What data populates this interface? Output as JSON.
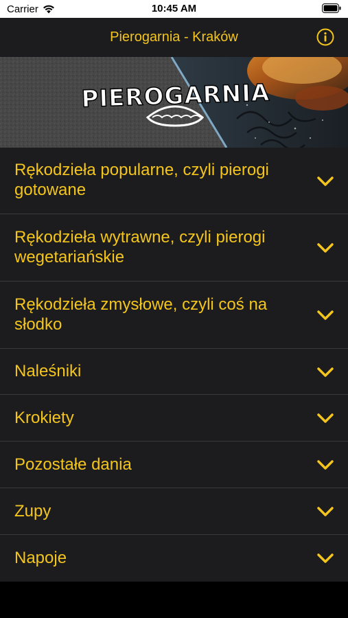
{
  "status_bar": {
    "carrier": "Carrier",
    "time": "10:45 AM"
  },
  "nav": {
    "title": "Pierogarnia - Kraków",
    "info_icon": "info-circle-icon"
  },
  "banner": {
    "logo_text": "PIEROGARNIA"
  },
  "menu": {
    "items": [
      {
        "label": "Rękodzieła popularne, czyli pierogi gotowane"
      },
      {
        "label": "Rękodzieła wytrawne, czyli pierogi wegetariańskie"
      },
      {
        "label": "Rękodzieła zmysłowe, czyli coś na słodko"
      },
      {
        "label": "Naleśniki"
      },
      {
        "label": "Krokiety"
      },
      {
        "label": "Pozostałe dania"
      },
      {
        "label": "Zupy"
      },
      {
        "label": "Napoje"
      }
    ]
  },
  "colors": {
    "accent": "#f4c51d",
    "background": "#1c1c1e",
    "divider": "#3a3a3c"
  }
}
